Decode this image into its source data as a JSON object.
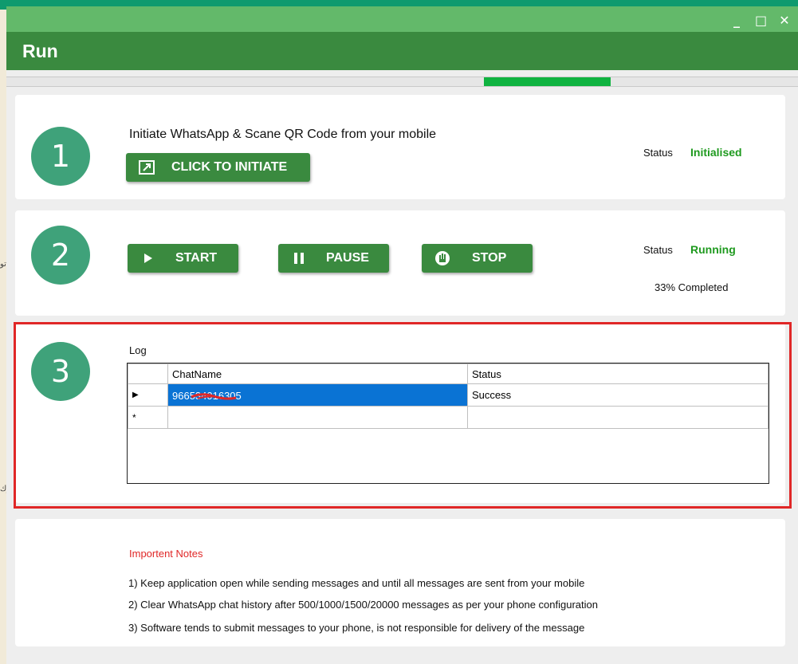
{
  "window": {
    "title": "Run",
    "controls": [
      "_",
      "□",
      "✕"
    ]
  },
  "background_fragments": [
    "تو",
    "رك"
  ],
  "progress": {
    "value_fraction": 0.33
  },
  "step1": {
    "number": "1",
    "instruction": "Initiate WhatsApp & Scane QR Code from your mobile",
    "button_label": "CLICK TO INITIATE",
    "status_label": "Status",
    "status_value": "Initialised"
  },
  "step2": {
    "number": "2",
    "start_label": "START",
    "pause_label": "PAUSE",
    "stop_label": "STOP",
    "status_label": "Status",
    "status_value": "Running",
    "completed_text": "33% Completed"
  },
  "step3": {
    "number": "3",
    "log_label": "Log",
    "columns": [
      "ChatName",
      "Status"
    ],
    "rows": [
      {
        "chat_name": "966534016305",
        "status": "Success"
      }
    ],
    "row_markers": [
      "▶",
      "*"
    ]
  },
  "notes": {
    "title": "Importent Notes",
    "items": [
      "1) Keep application open while sending messages and until all messages are sent from your mobile",
      "2) Clear WhatsApp chat history after 500/1000/1500/20000 messages as per your phone configuration",
      "3) Software tends to submit messages to your phone, is not responsible for delivery of the message"
    ]
  },
  "colors": {
    "accent": "#3a8a3f",
    "title_bar": "#63b96a",
    "status_ok": "#1f9a1f",
    "highlight": "#e02727",
    "selection": "#0a73d4"
  }
}
